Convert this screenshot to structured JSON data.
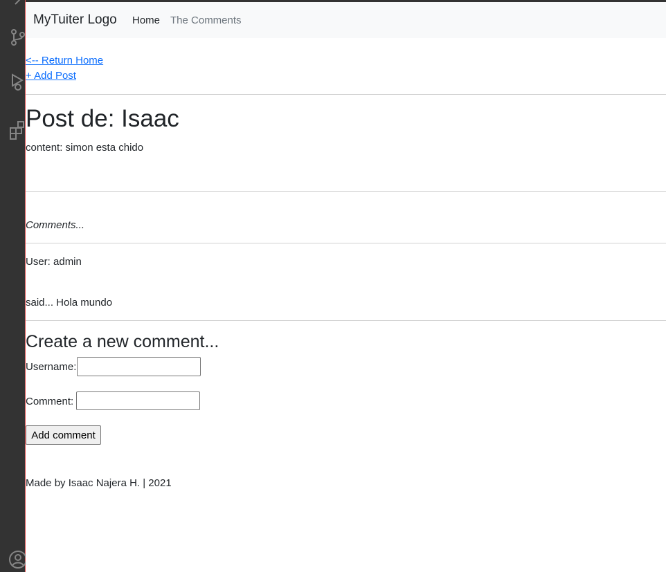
{
  "navbar": {
    "brand": "MyTuiter Logo",
    "links": [
      "Home",
      "The Comments"
    ]
  },
  "actions": {
    "return_home": "<-- Return Home",
    "add_post": "+ Add Post"
  },
  "post": {
    "title": "Post de: Isaac",
    "content": "content: simon esta chido"
  },
  "comments": {
    "heading": "Comments...",
    "items": [
      {
        "user": "User: admin",
        "said": "said... Hola mundo"
      }
    ]
  },
  "form": {
    "title": "Create a new comment...",
    "username_label": "Username:",
    "username_value": "",
    "comment_label": "Comment:",
    "comment_value": "",
    "submit_label": "Add comment"
  },
  "footer": {
    "text": "Made by Isaac Najera H. | 2021"
  },
  "colors": {
    "link": "#0d6efd",
    "navbar_bg": "#f8f9fa",
    "sidebar_bg": "#333333",
    "muted": "#6c757d"
  },
  "icons": [
    "source-control-icon",
    "debug-icon",
    "extensions-icon",
    "account-icon"
  ]
}
